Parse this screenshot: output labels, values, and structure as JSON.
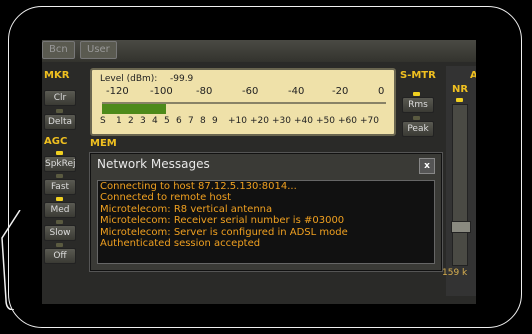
{
  "top": {
    "btn1": "Bcn",
    "btn2": "User"
  },
  "left": {
    "mkr_header": "MKR",
    "clr": "Clr",
    "delta": "Delta",
    "agc_header": "AGC",
    "spkrej": "SpkRej",
    "fast": "Fast",
    "med": "Med",
    "slow": "Slow",
    "off": "Off"
  },
  "meter": {
    "label": "Level (dBm):",
    "value": "-99.9",
    "db_ticks": [
      "-120",
      "-100",
      "-80",
      "-60",
      "-40",
      "-20",
      "0"
    ],
    "s_ticks": [
      "S",
      "1",
      "2",
      "3",
      "4",
      "5",
      "6",
      "7",
      "8",
      "9",
      "+10",
      "+20",
      "+30",
      "+40",
      "+50",
      "+60",
      "+70"
    ]
  },
  "smtr": {
    "header": "S-MTR",
    "rms": "Rms",
    "peak": "Peak"
  },
  "mem_header": "MEM",
  "right": {
    "label_a": "A",
    "nr": "NR",
    "freq": "159 k"
  },
  "dialog": {
    "title": "Network Messages",
    "close": "x",
    "lines": [
      "Connecting to host 87.12.5.130:8014...",
      "Connected to remote host",
      "Microtelecom: R8 vertical  antenna",
      "Microtelecom: Receiver serial number  is #03000",
      "Microtelecom: Server is configured in ADSL mode",
      "Authenticated session accepted"
    ]
  }
}
